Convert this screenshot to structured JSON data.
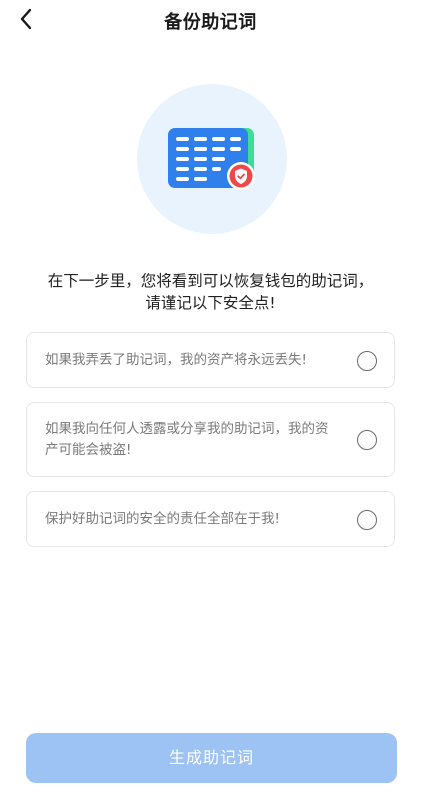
{
  "header": {
    "title": "备份助记词",
    "back_icon": "chevron-left-icon"
  },
  "illustration": {
    "icon": "mnemonic-card-shield-icon",
    "colors": {
      "circle_bg": "#e9f3fd",
      "card": "#2f80ed",
      "card_back": "#3ddc97",
      "badge": "#f04848"
    }
  },
  "intro": {
    "line1": "在下一步里，您将看到可以恢复钱包的助记词，",
    "line2": "请谨记以下安全点!"
  },
  "checklist": {
    "items": [
      {
        "text": "如果我弄丢了助记词，我的资产将永远丢失!",
        "checked": false
      },
      {
        "text": "如果我向任何人透露或分享我的助记词，我的资产可能会被盗!",
        "checked": false
      },
      {
        "text": "保护好助记词的安全的责任全部在于我!",
        "checked": false
      }
    ]
  },
  "footer": {
    "generate_label": "生成助记词",
    "button_color": "#9dc3f5"
  }
}
